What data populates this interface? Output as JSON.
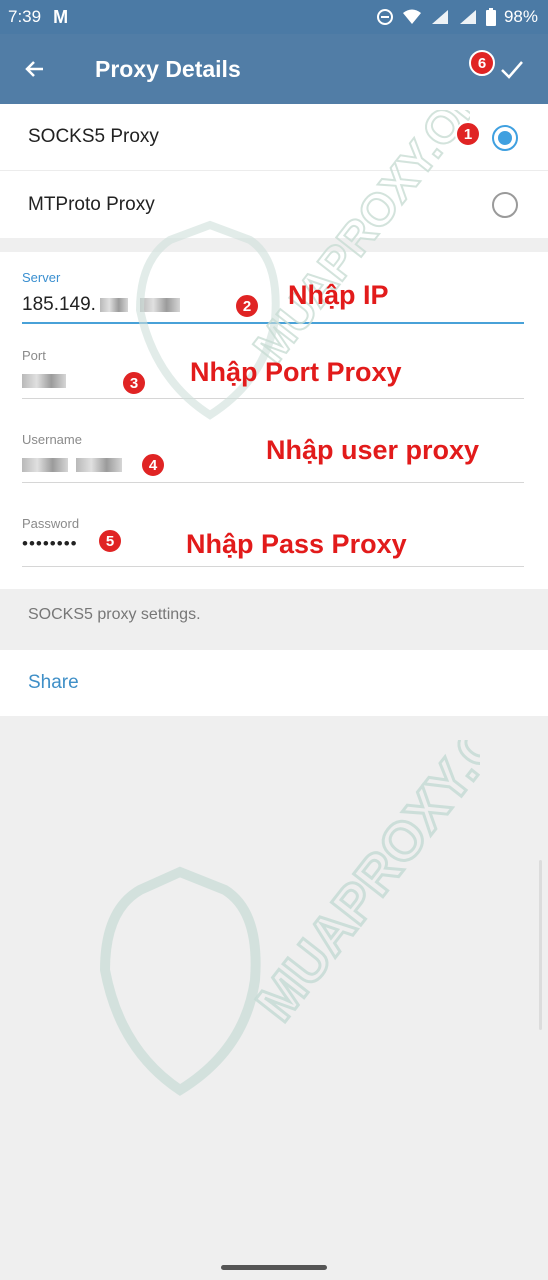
{
  "status_bar": {
    "time": "7:39",
    "notification_icon": "gmail-icon",
    "battery": "98%",
    "icons": [
      "dnd-icon",
      "wifi-icon",
      "signal-icon",
      "signal-icon",
      "battery-icon"
    ]
  },
  "app_bar": {
    "title": "Proxy Details",
    "back_icon": "back-arrow-icon",
    "save_icon": "check-icon"
  },
  "proxy_types": [
    {
      "label": "SOCKS5 Proxy",
      "selected": true
    },
    {
      "label": "MTProto Proxy",
      "selected": false
    }
  ],
  "fields": {
    "server": {
      "label": "Server",
      "value": "185.149."
    },
    "port": {
      "label": "Port",
      "value": ""
    },
    "username": {
      "label": "Username",
      "value": ""
    },
    "password": {
      "label": "Password",
      "value": "••••••••"
    }
  },
  "info_text": "SOCKS5 proxy settings.",
  "share_label": "Share",
  "annotations": {
    "steps": [
      "1",
      "2",
      "3",
      "4",
      "5",
      "6"
    ],
    "notes": [
      "Nhập IP",
      "Nhập Port Proxy",
      "Nhập user proxy",
      "Nhập Pass Proxy"
    ]
  },
  "watermark": "MUAPROXY.ORG",
  "colors": {
    "app_bar": "#517da6",
    "accent": "#3fa0e0",
    "annotation": "#e21b1b",
    "link": "#3f8fc7"
  }
}
